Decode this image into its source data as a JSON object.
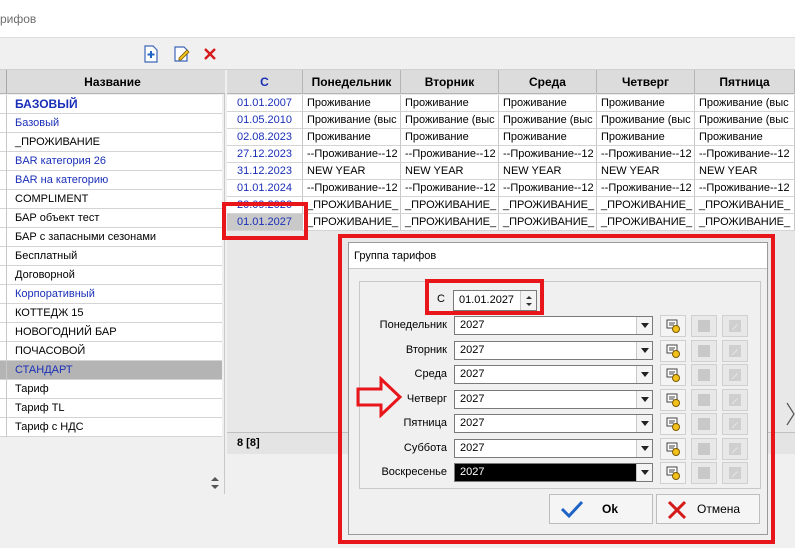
{
  "window": {
    "title": "рифов"
  },
  "toolbar": {
    "add_icon": "add-document-icon",
    "edit_icon": "edit-icon",
    "delete_icon": "delete-x-icon"
  },
  "left_list": {
    "header": "Название",
    "rows": [
      {
        "label": "БАЗОВЫЙ",
        "color": "#1a2fb8",
        "bold": true
      },
      {
        "label": "Базовый",
        "color": "#1a2fb8"
      },
      {
        "label": "_ПРОЖИВАНИЕ",
        "color": "#000000"
      },
      {
        "label": "BAR категория 26",
        "color": "#1a2fb8"
      },
      {
        "label": "BAR на категорию",
        "color": "#1a2fb8"
      },
      {
        "label": "COMPLIMENT",
        "color": "#000000"
      },
      {
        "label": "БАР объект тест",
        "color": "#000000"
      },
      {
        "label": "БАР с запасными сезонами",
        "color": "#000000"
      },
      {
        "label": "Бесплатный",
        "color": "#000000"
      },
      {
        "label": "Договорной",
        "color": "#000000"
      },
      {
        "label": "Корпоративный",
        "color": "#1a2fb8"
      },
      {
        "label": "КОТТЕДЖ 15",
        "color": "#000000"
      },
      {
        "label": "НОВОГОДНИЙ БАР",
        "color": "#000000"
      },
      {
        "label": "ПОЧАСОВОЙ",
        "color": "#000000"
      },
      {
        "label": "СТАНДАРТ",
        "color": "#1a2fb8",
        "selected": true
      },
      {
        "label": "Тариф",
        "color": "#000000"
      },
      {
        "label": "Тариф TL",
        "color": "#000000"
      },
      {
        "label": "Тариф с НДС",
        "color": "#000000"
      }
    ]
  },
  "grid": {
    "headers": [
      "С",
      "Понедельник",
      "Вторник",
      "Среда",
      "Четверг",
      "Пятница"
    ],
    "rows": [
      [
        "01.01.2007",
        "Проживание",
        "Проживание",
        "Проживание",
        "Проживание",
        "Проживание (выс"
      ],
      [
        "01.05.2010",
        "Проживание (выс",
        "Проживание (выс",
        "Проживание (выс",
        "Проживание (выс",
        "Проживание (выс"
      ],
      [
        "02.08.2023",
        "Проживание",
        "Проживание",
        "Проживание",
        "Проживание",
        "Проживание"
      ],
      [
        "27.12.2023",
        "--Проживание--12",
        "--Проживание--12",
        "--Проживание--12",
        "--Проживание--12",
        "--Проживание--12"
      ],
      [
        "31.12.2023",
        "NEW YEAR",
        "NEW YEAR",
        "NEW YEAR",
        "NEW YEAR",
        "NEW YEAR"
      ],
      [
        "01.01.2024",
        "--Проживание--12",
        "--Проживание--12",
        "--Проживание--12",
        "--Проживание--12",
        "--Проживание--12"
      ],
      [
        "20.09.2026",
        "_ПРОЖИВАНИЕ_",
        "_ПРОЖИВАНИЕ_",
        "_ПРОЖИВАНИЕ_",
        "_ПРОЖИВАНИЕ_",
        "_ПРОЖИВАНИЕ_"
      ],
      [
        "01.01.2027",
        "_ПРОЖИВАНИЕ_",
        "_ПРОЖИВАНИЕ_",
        "_ПРОЖИВАНИЕ_",
        "_ПРОЖИВАНИЕ_",
        "_ПРОЖИВАНИЕ_"
      ]
    ],
    "footer": "8 [8]"
  },
  "dialog": {
    "title": "Группа тарифов",
    "date_label": "С",
    "date_value": "01.01.2027",
    "days": [
      {
        "label": "Понедельник",
        "value": "2027"
      },
      {
        "label": "Вторник",
        "value": "2027"
      },
      {
        "label": "Среда",
        "value": "2027"
      },
      {
        "label": "Четверг",
        "value": "2027"
      },
      {
        "label": "Пятница",
        "value": "2027"
      },
      {
        "label": "Суббота",
        "value": "2027"
      },
      {
        "label": "Воскресенье",
        "value": "2027"
      }
    ],
    "ok_label": "Ok",
    "cancel_label": "Отмена"
  },
  "colors": {
    "highlight": "#e8161b",
    "link_blue": "#1a2fb8",
    "ok_check": "#1f63c6",
    "cancel_x": "#d51a1a"
  }
}
